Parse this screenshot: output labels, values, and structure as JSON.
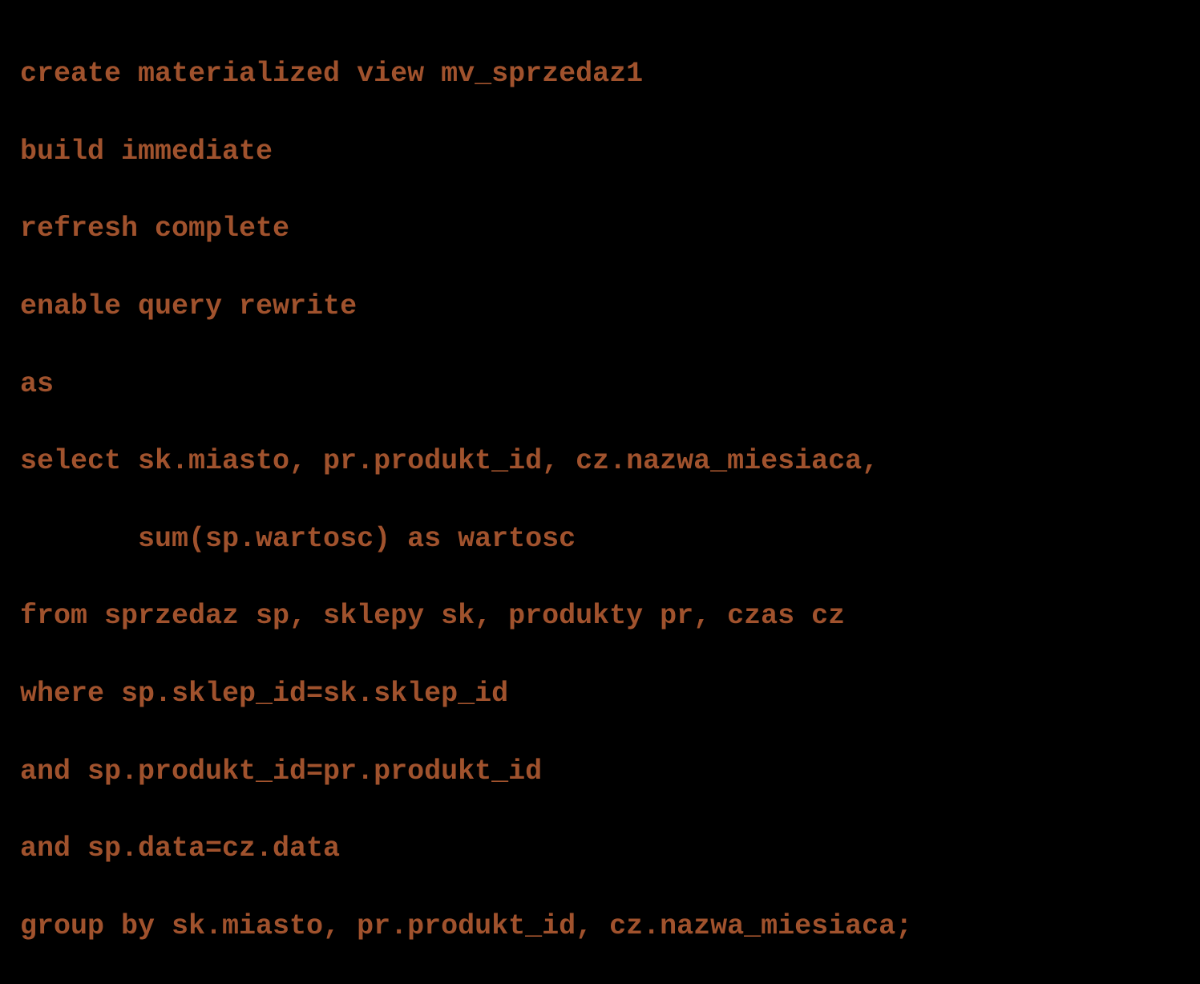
{
  "code": {
    "line1": "create materialized view mv_sprzedaz1",
    "line2": "build immediate",
    "line3": "refresh complete",
    "line4": "enable query rewrite",
    "line5": "as",
    "line6": "select sk.miasto, pr.produkt_id, cz.nazwa_miesiaca,",
    "line7": "       sum(sp.wartosc) as wartosc",
    "line8": "from sprzedaz sp, sklepy sk, produkty pr, czas cz",
    "line9": "where sp.sklep_id=sk.sklep_id",
    "line10": "and sp.produkt_id=pr.produkt_id",
    "line11": "and sp.data=cz.data",
    "line12": "group by sk.miasto, pr.produkt_id, cz.nazwa_miesiaca;"
  }
}
